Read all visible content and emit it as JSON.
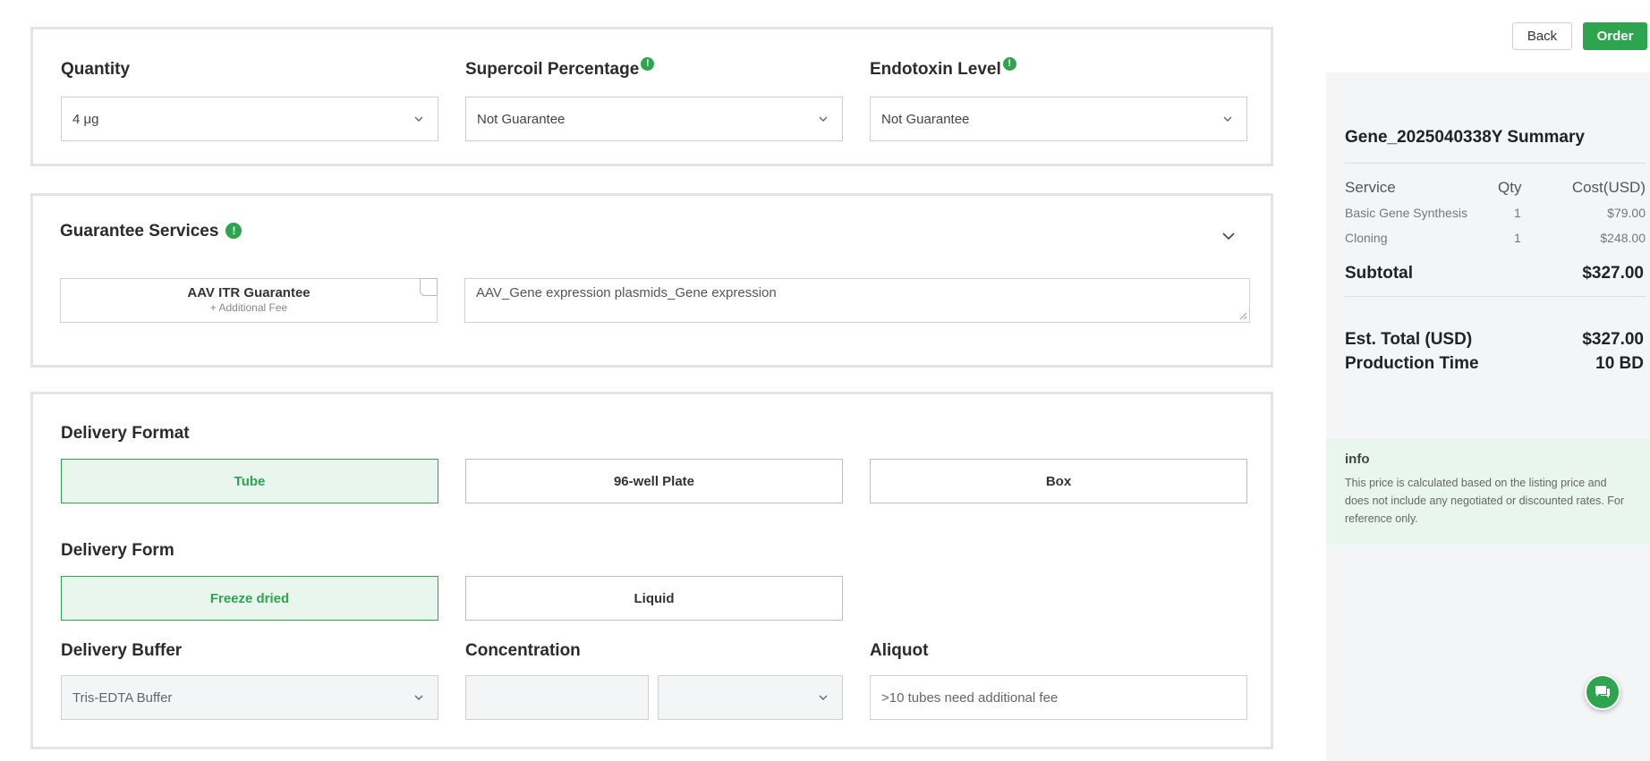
{
  "specs": {
    "quantity_label": "Quantity",
    "quantity_value": "4 μg",
    "supercoil_label": "Supercoil Percentage",
    "supercoil_value": "Not Guarantee",
    "endotoxin_label": "Endotoxin Level",
    "endotoxin_value": "Not Guarantee",
    "info_glyph": "!"
  },
  "guarantee": {
    "title": "Guarantee Services",
    "option_title": "AAV ITR Guarantee",
    "option_sub": "+ Additional Fee",
    "notes": "AAV_Gene expression plasmids_Gene expression"
  },
  "delivery": {
    "format_label": "Delivery Format",
    "formats": [
      "Tube",
      "96-well Plate",
      "Box"
    ],
    "selected_format": "Tube",
    "form_label": "Delivery Form",
    "forms": [
      "Freeze dried",
      "Liquid"
    ],
    "selected_form": "Freeze dried",
    "buffer_label": "Delivery Buffer",
    "buffer_value": "Tris-EDTA Buffer",
    "concentration_label": "Concentration",
    "concentration_value": "",
    "concentration_unit": "",
    "aliquot_label": "Aliquot",
    "aliquot_placeholder": ">10 tubes need additional fee"
  },
  "actions": {
    "back": "Back",
    "order": "Order"
  },
  "summary": {
    "title": "Gene_2025040338Y Summary",
    "headers": [
      "Service",
      "Qty",
      "Cost(USD)"
    ],
    "rows": [
      {
        "service": "Basic Gene Synthesis",
        "qty": "1",
        "cost": "$79.00"
      },
      {
        "service": "Cloning",
        "qty": "1",
        "cost": "$248.00"
      }
    ],
    "subtotal_label": "Subtotal",
    "subtotal_value": "$327.00",
    "total_label": "Est. Total (USD)",
    "total_value": "$327.00",
    "production_label": "Production Time",
    "production_value": "10 BD",
    "info_title": "info",
    "info_text": "This price is calculated based on the listing price and does not include any negotiated or discounted rates. For reference only."
  },
  "colors": {
    "accent": "#2ea44f",
    "selected_bg": "#e8f6ee",
    "panel_bg": "#f4f5f7"
  },
  "icons": [
    "info-icon",
    "chevron-down-icon",
    "chat-icon",
    "resize-grip-icon",
    "checkbox-icon"
  ]
}
